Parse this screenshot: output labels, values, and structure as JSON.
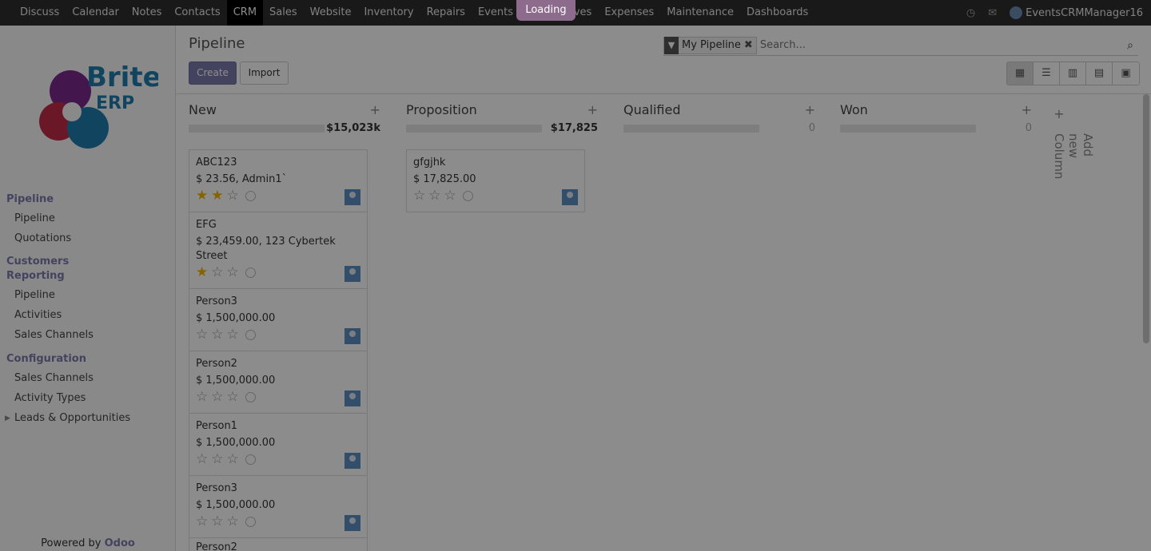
{
  "topbar": {
    "menu": [
      "Discuss",
      "Calendar",
      "Notes",
      "Contacts",
      "CRM",
      "Sales",
      "Website",
      "Inventory",
      "Repairs",
      "Events",
      "Em",
      "Leaves",
      "Expenses",
      "Maintenance",
      "Dashboards"
    ],
    "active": "CRM",
    "loading": "Loading",
    "user": "EventsCRMManager16"
  },
  "logo": {
    "text_top": "Brite",
    "text_bottom": "ERP"
  },
  "sidebar": {
    "pipeline_section": "Pipeline",
    "pipeline_items": [
      "Pipeline",
      "Quotations"
    ],
    "customers_section": "Customers",
    "reporting_section": "Reporting",
    "reporting_items": [
      "Pipeline",
      "Activities",
      "Sales Channels"
    ],
    "configuration_section": "Configuration",
    "configuration_items": [
      "Sales Channels",
      "Activity Types",
      "Leads & Opportunities"
    ],
    "powered_prefix": "Powered by",
    "powered_brand": "Odoo"
  },
  "control": {
    "title": "Pipeline",
    "create": "Create",
    "import": "Import",
    "facet": "My Pipeline",
    "search_placeholder": "Search..."
  },
  "columns": [
    {
      "title": "New",
      "total": "$15,023k"
    },
    {
      "title": "Proposition",
      "total": "$17,825"
    },
    {
      "title": "Qualified",
      "total": "0"
    },
    {
      "title": "Won",
      "total": "0"
    }
  ],
  "add_column": "Add new Column",
  "cards_new": [
    {
      "name": "ABC123",
      "desc": "$ 23.56, Admin1`",
      "stars": 2
    },
    {
      "name": "EFG",
      "desc": "$ 23,459.00, 123 Cybertek Street",
      "stars": 1
    },
    {
      "name": "Person3",
      "desc": "$ 1,500,000.00",
      "stars": 0
    },
    {
      "name": "Person2",
      "desc": "$ 1,500,000.00",
      "stars": 0
    },
    {
      "name": "Person1",
      "desc": "$ 1,500,000.00",
      "stars": 0
    },
    {
      "name": "Person3",
      "desc": "$ 1,500,000.00",
      "stars": 0
    },
    {
      "name": "Person2",
      "desc": "",
      "stars": 0
    }
  ],
  "cards_proposition": [
    {
      "name": "gfgjhk",
      "desc": "$ 17,825.00",
      "stars": 0
    }
  ],
  "icons": {
    "filter": "filter-icon",
    "remove": "close-icon",
    "search": "search-icon",
    "views": [
      "kanban-icon",
      "list-icon",
      "graph-icon",
      "pivot-icon",
      "calendar-icon"
    ],
    "clock": "clock-icon",
    "chat": "chat-icon"
  }
}
